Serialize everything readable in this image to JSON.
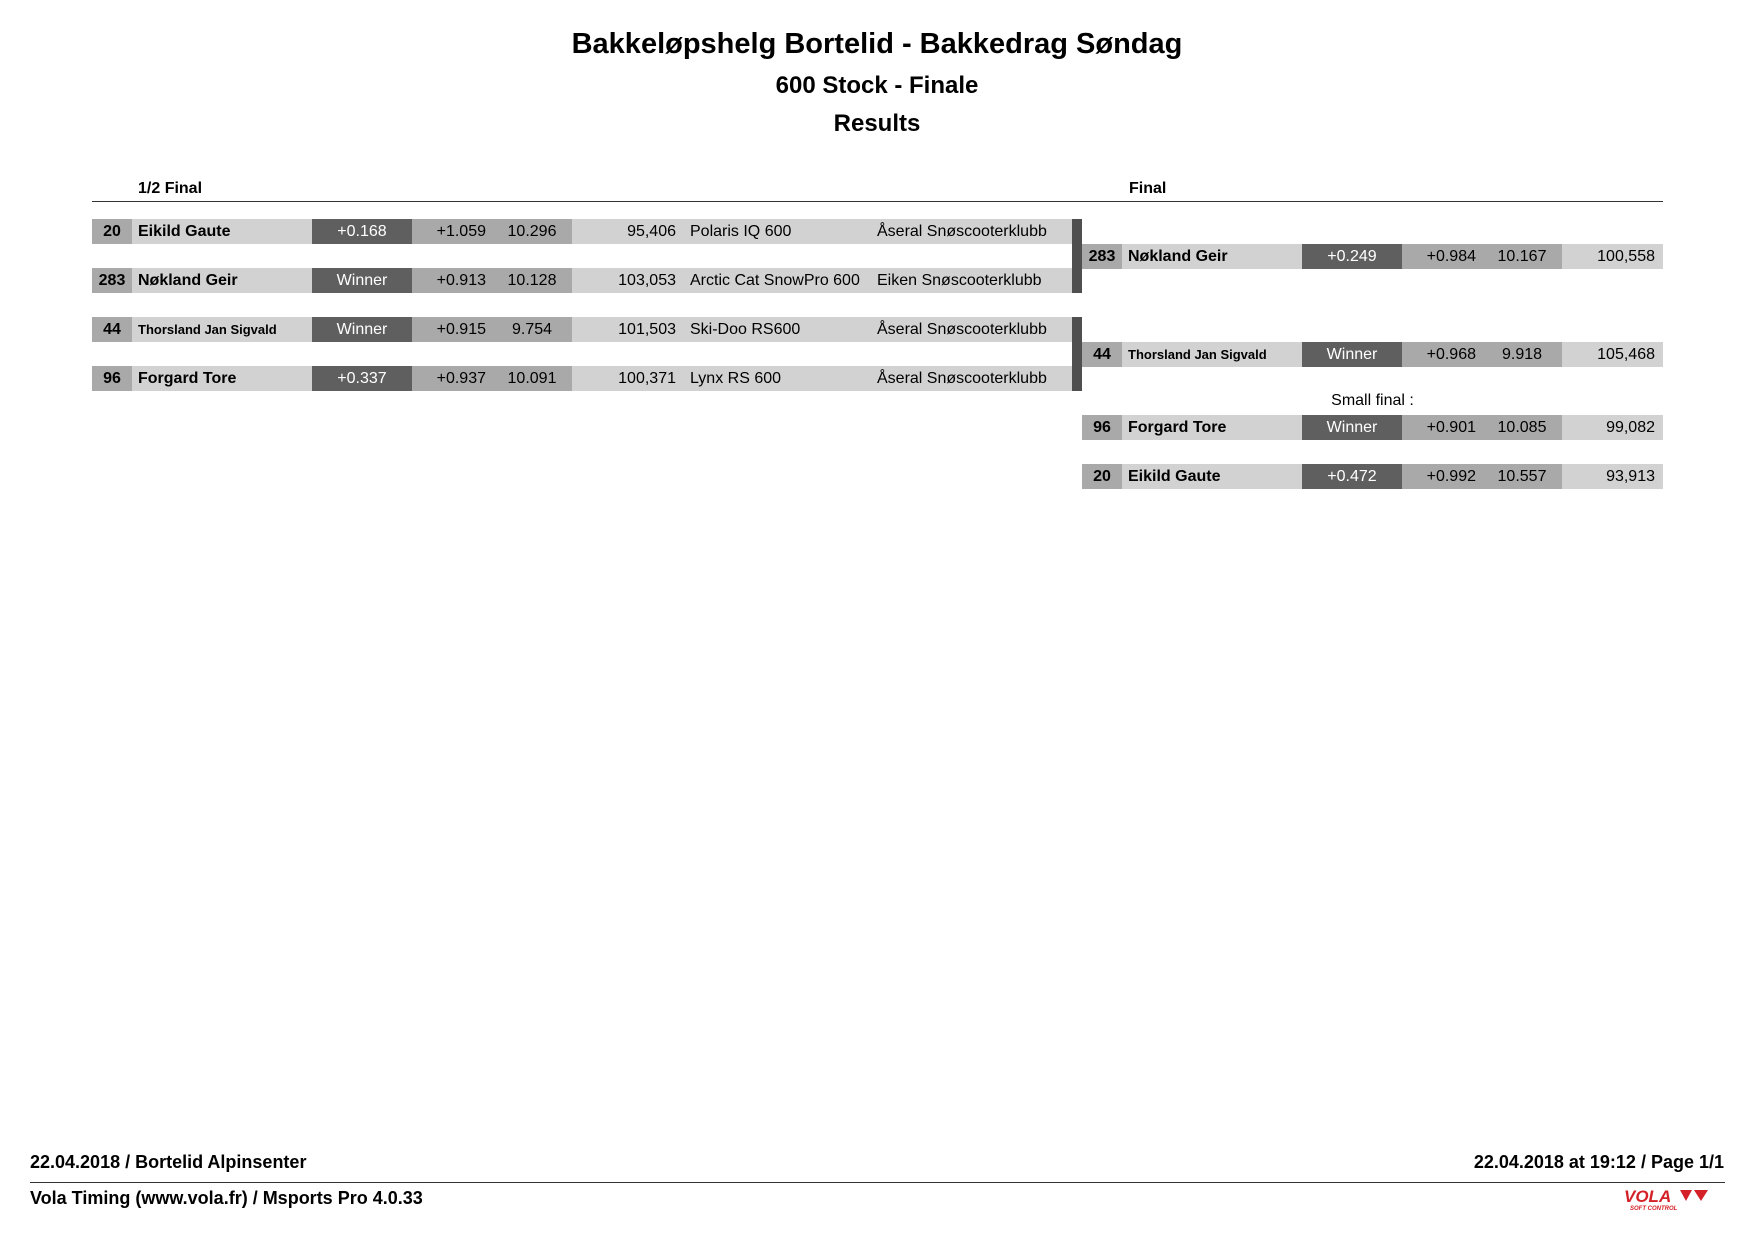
{
  "header": {
    "title": "Bakkeløpshelg Bortelid - Bakkedrag Søndag",
    "subtitle": "600 Stock - Finale",
    "heading": "Results"
  },
  "sections": {
    "semi_label": "1/2 Final",
    "final_label": "Final",
    "small_final_label": "Small final :"
  },
  "semi_final": [
    {
      "bib": "20",
      "name": "Eikild Gaute",
      "result": "+0.168",
      "reaction": "+1.059",
      "time": "10.296",
      "speed": "95,406",
      "machine": "Polaris IQ 600",
      "club": "Åseral Snøscooterklubb"
    },
    {
      "bib": "283",
      "name": "Nøkland Geir",
      "result": "Winner",
      "reaction": "+0.913",
      "time": "10.128",
      "speed": "103,053",
      "machine": "Arctic Cat SnowPro 600",
      "club": "Eiken Snøscooterklubb"
    },
    {
      "bib": "44",
      "name": "Thorsland Jan Sigvald",
      "result": "Winner",
      "reaction": "+0.915",
      "time": "9.754",
      "speed": "101,503",
      "machine": "Ski-Doo RS600",
      "club": "Åseral Snøscooterklubb"
    },
    {
      "bib": "96",
      "name": "Forgard Tore",
      "result": "+0.337",
      "reaction": "+0.937",
      "time": "10.091",
      "speed": "100,371",
      "machine": "Lynx RS 600",
      "club": "Åseral Snøscooterklubb"
    }
  ],
  "final": [
    {
      "bib": "283",
      "name": "Nøkland Geir",
      "result": "+0.249",
      "reaction": "+0.984",
      "time": "10.167",
      "speed": "100,558"
    },
    {
      "bib": "44",
      "name": "Thorsland Jan Sigvald",
      "result": "Winner",
      "reaction": "+0.968",
      "time": "9.918",
      "speed": "105,468"
    }
  ],
  "small_final": [
    {
      "bib": "96",
      "name": "Forgard Tore",
      "result": "Winner",
      "reaction": "+0.901",
      "time": "10.085",
      "speed": "99,082"
    },
    {
      "bib": "20",
      "name": "Eikild Gaute",
      "result": "+0.472",
      "reaction": "+0.992",
      "time": "10.557",
      "speed": "93,913"
    }
  ],
  "footer": {
    "left_top": "22.04.2018  /  Bortelid Alpinsenter",
    "right_top": "22.04.2018 at 19:12  /  Page 1/1",
    "left_bottom": "Vola Timing (www.vola.fr) / Msports Pro 4.0.33",
    "logo_text": "VOLA",
    "logo_subtext": "SOFT CONTROL",
    "logo_color": "#d42027"
  }
}
